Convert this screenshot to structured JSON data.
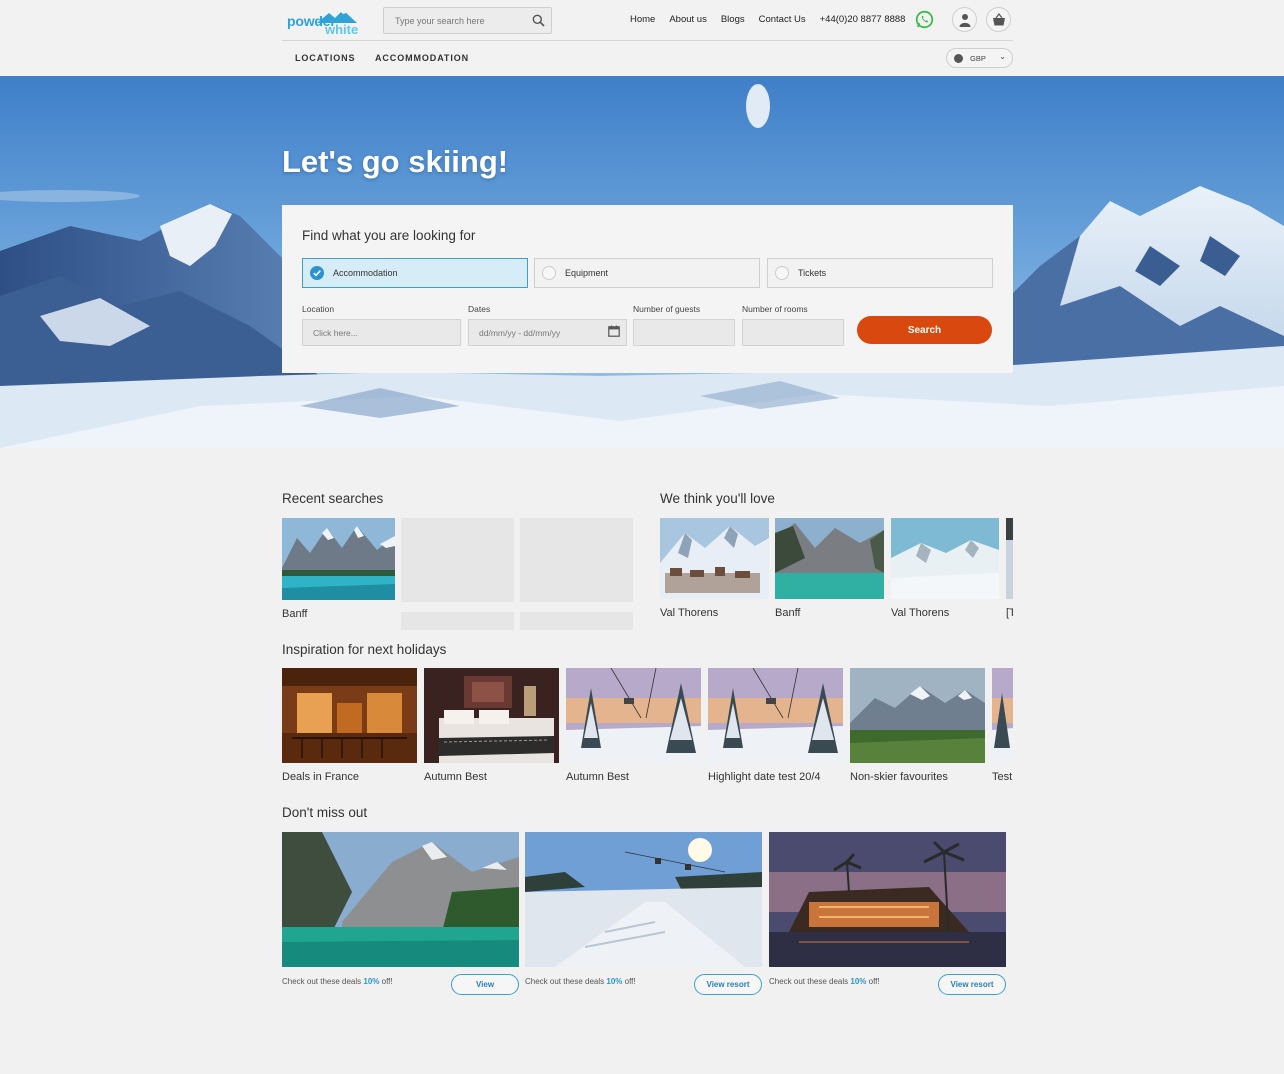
{
  "header": {
    "logo_line1": "powder",
    "logo_line2": "white",
    "search_placeholder": "Type your search here",
    "nav": [
      "Home",
      "About us",
      "Blogs",
      "Contact Us"
    ],
    "phone": "+44(0)20 8877 8888",
    "subnav": [
      "LOCATIONS",
      "ACCOMMODATION"
    ],
    "currency": "GBP"
  },
  "hero": {
    "title": "Let's go skiing!",
    "card_title": "Find what you are looking for",
    "tabs": [
      "Accommodation",
      "Equipment",
      "Tickets"
    ],
    "active_tab": "Accommodation",
    "fields": {
      "location_label": "Location",
      "location_placeholder": "Click here...",
      "dates_label": "Dates",
      "dates_placeholder": "dd/mm/yy - dd/mm/yy",
      "guests_label": "Number of guests",
      "rooms_label": "Number of rooms"
    },
    "search_button": "Search"
  },
  "recent": {
    "title": "Recent searches",
    "items": [
      "Banff"
    ]
  },
  "love": {
    "title": "We think you'll love",
    "items": [
      "Val Thorens",
      "Banff",
      "Val Thorens",
      "[T"
    ]
  },
  "inspiration": {
    "title": "Inspiration for next holidays",
    "items": [
      "Deals in France",
      "Autumn Best",
      "Autumn Best",
      "Highlight date test 20/4",
      "Non-skier favourites",
      "Test"
    ]
  },
  "dont_miss": {
    "title": "Don't miss out",
    "items": [
      {
        "text_prefix": "Check out these deals ",
        "discount": "10%",
        "text_suffix": " off!",
        "button": "View"
      },
      {
        "text_prefix": "Check out these deals ",
        "discount": "10%",
        "text_suffix": " off!",
        "button": "View resort"
      },
      {
        "text_prefix": "Check out these deals ",
        "discount": "10%",
        "text_suffix": " off!",
        "button": "View resort"
      }
    ]
  },
  "colors": {
    "accent_blue": "#2b94cf",
    "search_orange": "#d9480f",
    "whatsapp_green": "#3cbb4a",
    "background": "#f1f1f1"
  },
  "icons": [
    "search-icon",
    "whatsapp-icon",
    "user-icon",
    "basket-icon",
    "globe-icon",
    "chevron-down-icon",
    "check-icon",
    "calendar-icon"
  ]
}
